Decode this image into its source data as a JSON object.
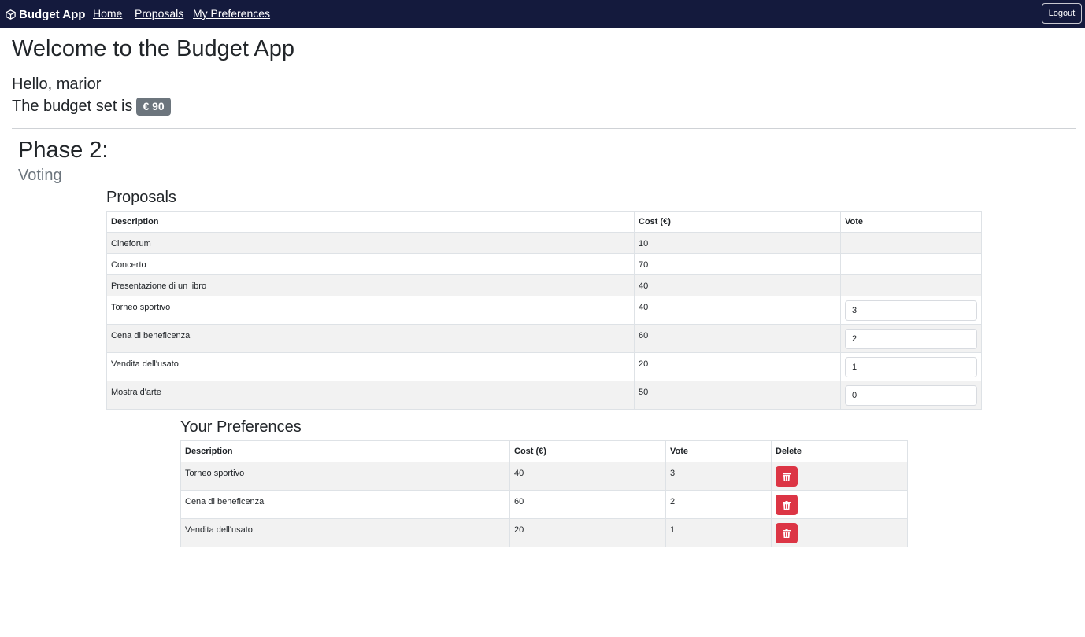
{
  "navbar": {
    "brand": "Budget App",
    "brand_icon": "box-seam-icon",
    "links": [
      "Home",
      "Proposals",
      "My Preferences"
    ],
    "logout_label": "Logout"
  },
  "header": {
    "welcome": "Welcome to the Budget App",
    "hello": "Hello, marior",
    "budget_label": "The budget set is",
    "budget_value": "€ 90"
  },
  "phase": {
    "title": "Phase 2:",
    "subtitle": "Voting"
  },
  "proposals": {
    "title": "Proposals",
    "columns": [
      "Description",
      "Cost (€)",
      "Vote"
    ],
    "rows": [
      {
        "description": "Cineforum",
        "cost": "10",
        "vote": null
      },
      {
        "description": "Concerto",
        "cost": "70",
        "vote": null
      },
      {
        "description": "Presentazione di un libro",
        "cost": "40",
        "vote": null
      },
      {
        "description": "Torneo sportivo",
        "cost": "40",
        "vote": "3"
      },
      {
        "description": "Cena di beneficenza",
        "cost": "60",
        "vote": "2"
      },
      {
        "description": "Vendita dell'usato",
        "cost": "20",
        "vote": "1"
      },
      {
        "description": "Mostra d'arte",
        "cost": "50",
        "vote": "0"
      }
    ]
  },
  "preferences": {
    "title": "Your Preferences",
    "columns": [
      "Description",
      "Cost (€)",
      "Vote",
      "Delete"
    ],
    "delete_icon": "trash-icon",
    "rows": [
      {
        "description": "Torneo sportivo",
        "cost": "40",
        "vote": "3"
      },
      {
        "description": "Cena di beneficenza",
        "cost": "60",
        "vote": "2"
      },
      {
        "description": "Vendita dell'usato",
        "cost": "20",
        "vote": "1"
      }
    ]
  },
  "colors": {
    "navbar_bg": "#141a3d",
    "badge_bg": "#6c757d",
    "delete_bg": "#dc3545",
    "stripe_bg": "#f2f2f2"
  }
}
